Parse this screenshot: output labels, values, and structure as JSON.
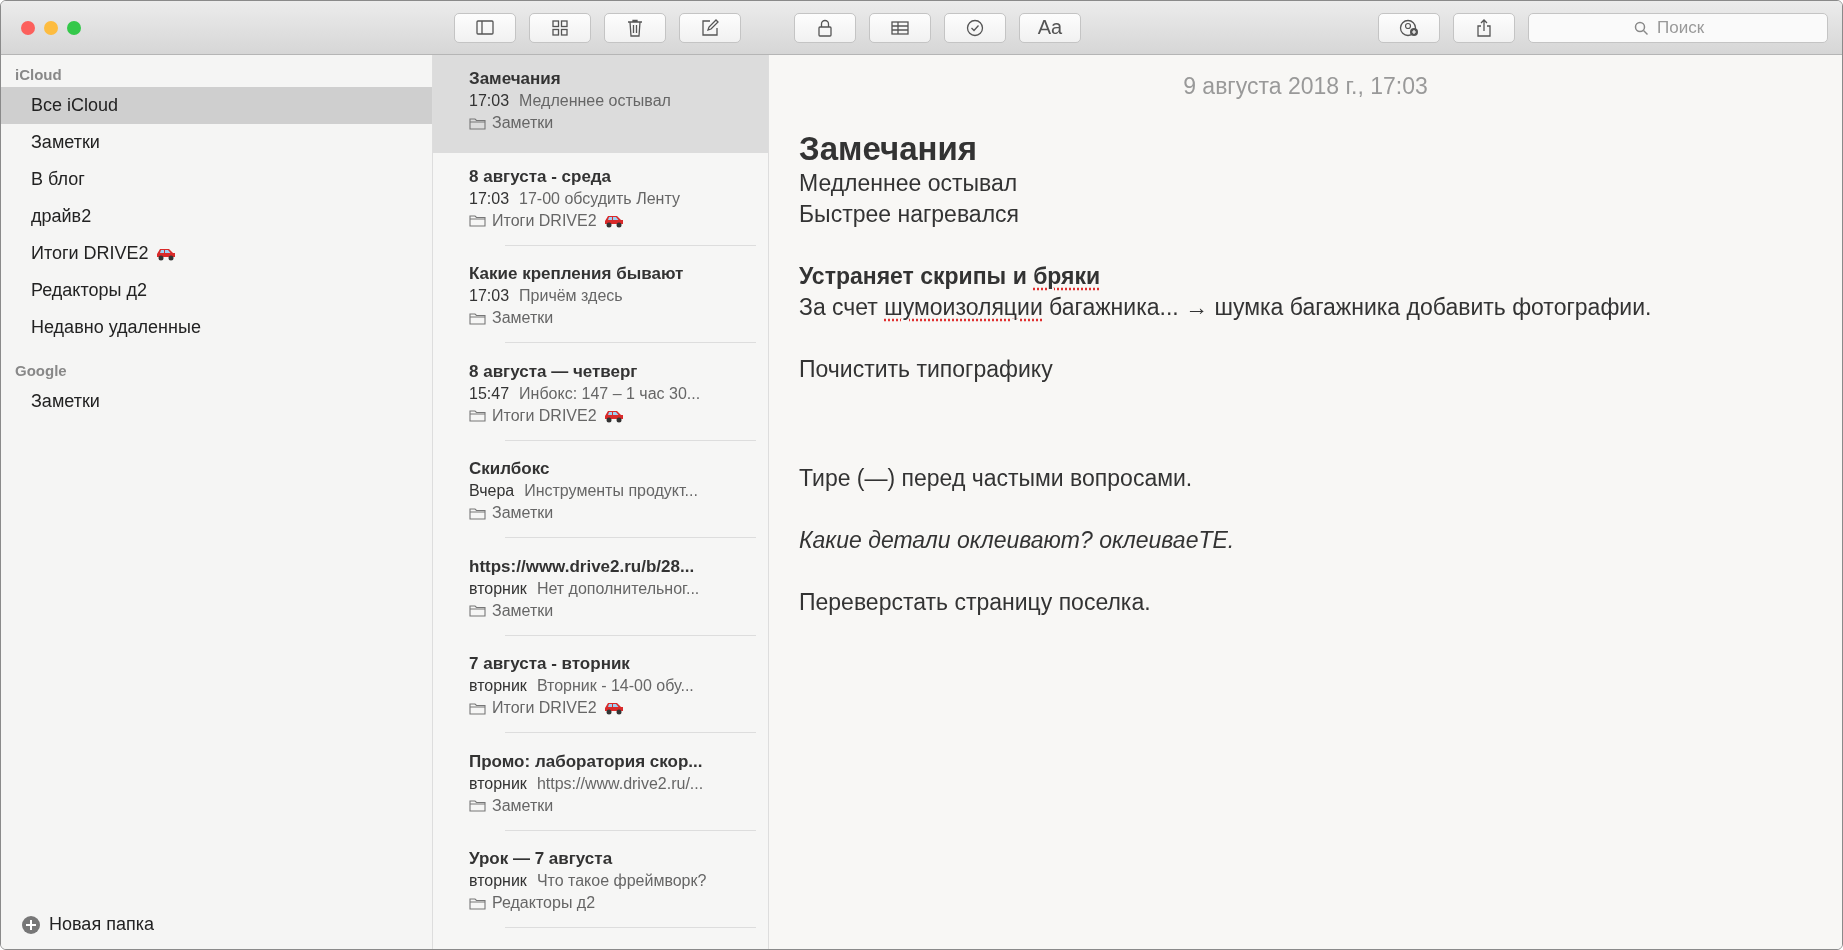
{
  "toolbar": {
    "buttons_left": [
      {
        "kind": "sidebar"
      },
      {
        "kind": "grid"
      },
      {
        "kind": "trash"
      },
      {
        "kind": "compose"
      }
    ],
    "buttons_mid": [
      {
        "kind": "lock"
      },
      {
        "kind": "table"
      },
      {
        "kind": "checklist"
      },
      {
        "kind": "format",
        "label": "Aa"
      }
    ],
    "buttons_right": [
      {
        "kind": "add-person"
      },
      {
        "kind": "share"
      }
    ],
    "search": {
      "placeholder": "Поиск"
    }
  },
  "sidebar": {
    "sections": [
      {
        "title": "iCloud",
        "items": [
          {
            "label": "Все iCloud",
            "selected": true,
            "car": false
          },
          {
            "label": "Заметки",
            "selected": false,
            "car": false
          },
          {
            "label": "В блог",
            "selected": false,
            "car": false
          },
          {
            "label": "драйв2",
            "selected": false,
            "car": false
          },
          {
            "label": "Итоги DRIVE2",
            "selected": false,
            "car": true
          },
          {
            "label": "Редакторы д2",
            "selected": false,
            "car": false
          },
          {
            "label": "Недавно удаленные",
            "selected": false,
            "car": false
          }
        ]
      },
      {
        "title": "Google",
        "items": [
          {
            "label": "Заметки",
            "selected": false,
            "car": false
          }
        ]
      }
    ],
    "new_folder": "Новая папка"
  },
  "notes": [
    {
      "title": "Замечания",
      "time": "17:03",
      "preview": "Медленнее остывал",
      "folder": "Заметки",
      "car": false,
      "selected": true
    },
    {
      "title": "8 августа - среда",
      "time": "17:03",
      "preview": "17-00 обсудить Ленту",
      "folder": "Итоги DRIVE2",
      "car": true,
      "selected": false
    },
    {
      "title": "Какие крепления бывают",
      "time": "17:03",
      "preview": "Причём здесь",
      "folder": "Заметки",
      "car": false,
      "selected": false
    },
    {
      "title": "8 августа — четверг",
      "time": "15:47",
      "preview": "Инбокс: 147 – 1 час 30...",
      "folder": "Итоги DRIVE2",
      "car": true,
      "selected": false
    },
    {
      "title": "Скилбокс",
      "time": "Вчера",
      "preview": "Инструменты продукт...",
      "folder": "Заметки",
      "car": false,
      "selected": false
    },
    {
      "title": "https://www.drive2.ru/b/28...",
      "time": "вторник",
      "preview": "Нет дополнительног...",
      "folder": "Заметки",
      "car": false,
      "selected": false
    },
    {
      "title": "7 августа - вторник",
      "time": "вторник",
      "preview": "Вторник - 14-00 обу...",
      "folder": "Итоги DRIVE2",
      "car": true,
      "selected": false
    },
    {
      "title": "Промо: лаборатория скор...",
      "time": "вторник",
      "preview": "https://www.drive2.ru/...",
      "folder": "Заметки",
      "car": false,
      "selected": false
    },
    {
      "title": "Урок — 7 августа",
      "time": "вторник",
      "preview": "Что такое фреймворк?",
      "folder": "Редакторы д2",
      "car": false,
      "selected": false
    }
  ],
  "note": {
    "date": "9 августа 2018 г., 17:03",
    "blocks": [
      {
        "kind": "title",
        "spans": [
          {
            "text": "Замечания",
            "misspelled": false
          }
        ]
      },
      {
        "kind": "line",
        "spans": [
          {
            "text": "Медленнее остывал",
            "misspelled": false
          }
        ]
      },
      {
        "kind": "line",
        "spans": [
          {
            "text": "Быстрее нагревался",
            "misspelled": false
          }
        ]
      },
      {
        "kind": "heading",
        "spans": [
          {
            "text": "Устраняет скрипы и ",
            "misspelled": false
          },
          {
            "text": "бряки",
            "misspelled": true
          }
        ]
      },
      {
        "kind": "line",
        "spans": [
          {
            "text": "За счет ",
            "misspelled": false
          },
          {
            "text": "шумоизоляции",
            "misspelled": true
          },
          {
            "text": " багажника... → шумка багажника добавить фотографии.",
            "misspelled": false
          }
        ]
      },
      {
        "kind": "paragraph",
        "spans": [
          {
            "text": "Почистить типографику",
            "misspelled": false
          }
        ]
      },
      {
        "kind": "section",
        "spans": [
          {
            "text": "Тире (—) перед частыми вопросами.",
            "misspelled": false
          }
        ]
      },
      {
        "kind": "italic",
        "spans": [
          {
            "text": "Какие детали оклеивают? оклеиваеТЕ.",
            "misspelled": false
          }
        ]
      },
      {
        "kind": "paragraph",
        "spans": [
          {
            "text": "Переверстать страницу поселка.",
            "misspelled": false
          }
        ]
      }
    ]
  }
}
